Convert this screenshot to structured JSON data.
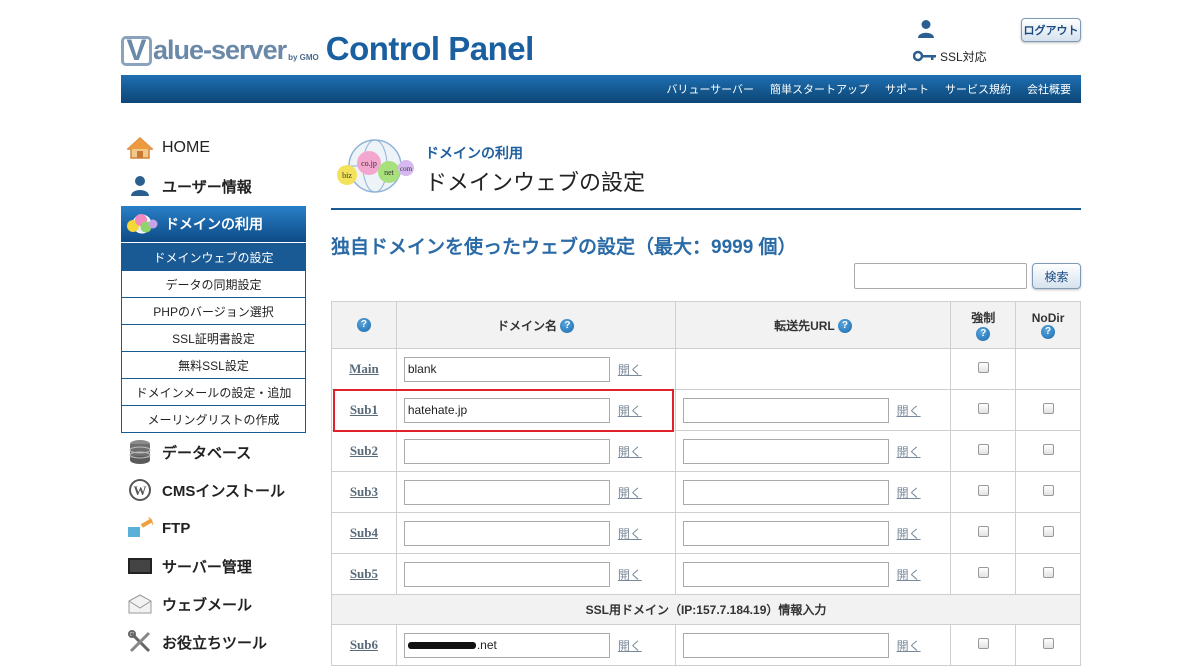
{
  "header": {
    "logo_v": "V",
    "logo_word": "alue-server",
    "logo_gmo": "by GMO",
    "logo_cp": "Control Panel",
    "ssl_label": "SSL対応",
    "logout_label": "ログアウト"
  },
  "topnav": [
    "バリューサーバー",
    "簡単スタートアップ",
    "サポート",
    "サービス規約",
    "会社概要"
  ],
  "sidebar": {
    "top_items": [
      {
        "label": "HOME",
        "icon": "home-icon"
      },
      {
        "label": "ユーザー情報",
        "icon": "user-icon"
      }
    ],
    "active_label": "ドメインの利用",
    "submenu": [
      "ドメインウェブの設定",
      "データの同期設定",
      "PHPのバージョン選択",
      "SSL証明書設定",
      "無料SSL設定",
      "ドメインメールの設定・追加",
      "メーリングリストの作成"
    ],
    "bottom_items": [
      {
        "label": "データベース",
        "icon": "database-icon"
      },
      {
        "label": "CMSインストール",
        "icon": "wordpress-icon"
      },
      {
        "label": "FTP",
        "icon": "ftp-icon"
      },
      {
        "label": "サーバー管理",
        "icon": "server-icon"
      },
      {
        "label": "ウェブメール",
        "icon": "webmail-icon"
      },
      {
        "label": "お役立ちツール",
        "icon": "tools-icon"
      }
    ]
  },
  "page": {
    "globe_labels": [
      "biz",
      "co.jp",
      "net",
      "com"
    ],
    "subtitle": "ドメインの利用",
    "title": "ドメインウェブの設定",
    "section_title": "独自ドメインを使ったウェブの設定（最大：9999 個）",
    "search_placeholder": "",
    "search_button": "検索"
  },
  "table": {
    "headers": {
      "help": "?",
      "domain": "ドメイン名",
      "redirect": "転送先URL",
      "force": "強制",
      "nodir": "NoDir"
    },
    "open_label": "開く",
    "rows": [
      {
        "label": "Main",
        "domain": "blank",
        "redirect": null
      },
      {
        "label": "Sub1",
        "domain": "hatehate.jp",
        "redirect": ""
      },
      {
        "label": "Sub2",
        "domain": "",
        "redirect": ""
      },
      {
        "label": "Sub3",
        "domain": "",
        "redirect": ""
      },
      {
        "label": "Sub4",
        "domain": "",
        "redirect": ""
      },
      {
        "label": "Sub5",
        "domain": "",
        "redirect": ""
      }
    ],
    "ssl_row_label": "SSL用ドメイン（IP:157.7.184.19）情報入力",
    "ssl_rows": [
      {
        "label": "Sub6",
        "domain_suffix": ".net",
        "redirect": ""
      }
    ]
  }
}
